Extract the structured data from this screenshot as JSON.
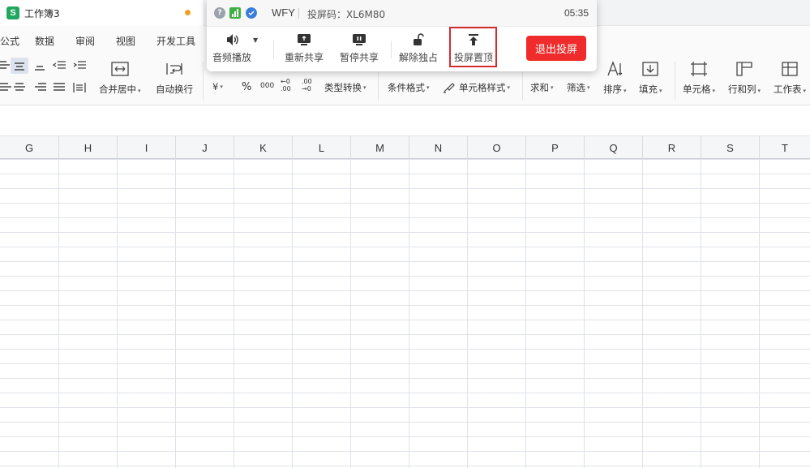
{
  "window": {
    "doc_title": "工作簿3",
    "app_logo_letter": "S"
  },
  "menu": {
    "items": [
      "公式",
      "数据",
      "审阅",
      "视图",
      "开发工具"
    ]
  },
  "ribbon": {
    "merge_center": "合并居中",
    "auto_wrap": "自动换行",
    "currency": "¥",
    "percent": "%",
    "thousands": "000",
    "dec_inc": "←0 .00",
    "dec_dec": ".00 →0",
    "type_convert": "类型转换",
    "cond_format": "条件格式",
    "cell_style": "单元格样式",
    "sum": "求和",
    "filter": "筛选",
    "sort": "排序",
    "fill": "填充",
    "cell": "单元格",
    "row_col": "行和列",
    "worksheet": "工作表"
  },
  "grid": {
    "columns": [
      "G",
      "H",
      "I",
      "J",
      "K",
      "L",
      "M",
      "N",
      "O",
      "P",
      "Q",
      "R",
      "S",
      "T"
    ]
  },
  "share": {
    "name": "WFY",
    "code_label": "投屏码：XL6M80",
    "time": "05:35",
    "buttons": {
      "audio": "音频播放",
      "reshare": "重新共享",
      "pause": "暂停共享",
      "unlock": "解除独占",
      "pin": "投屏置顶"
    },
    "exit": "退出投屏",
    "colors": {
      "exit_bg": "#ef2b2b",
      "highlight": "#d42b2b",
      "signal": "#3cb043",
      "shield": "#3b7ddd"
    }
  }
}
